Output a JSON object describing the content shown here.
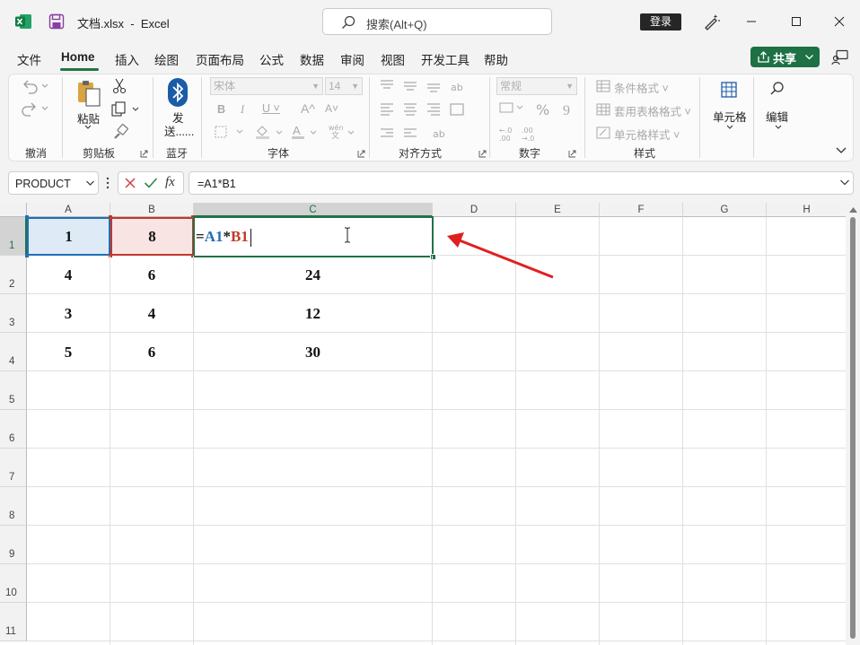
{
  "window": {
    "filename": "文档.xlsx",
    "separator": "-",
    "app": "Excel",
    "search_placeholder": "搜索(Alt+Q)",
    "login_label": "登录"
  },
  "tabs": [
    "文件",
    "Home",
    "插入",
    "绘图",
    "页面布局",
    "公式",
    "数据",
    "审阅",
    "视图",
    "开发工具",
    "帮助"
  ],
  "active_tab": "Home",
  "share_label": "共享",
  "ribbon": {
    "undo_group": "撤消",
    "clipboard": {
      "paste": "粘贴",
      "label": "剪贴板"
    },
    "bluetooth": {
      "send_line1": "发",
      "send_line2": "送......",
      "label": "蓝牙"
    },
    "font": {
      "name": "宋体",
      "size": "14",
      "label": "字体"
    },
    "alignment": {
      "label": "对齐方式"
    },
    "number": {
      "format": "常规",
      "label": "数字"
    },
    "styles": {
      "conditional": "条件格式",
      "table": "套用表格格式",
      "cell_styles": "单元格样式",
      "label": "样式"
    },
    "cells_label": "单元格",
    "editing_label": "编辑"
  },
  "formula_bar": {
    "name_box": "PRODUCT",
    "formula": "=A1*B1"
  },
  "sheet": {
    "columns": [
      "A",
      "B",
      "C",
      "D",
      "E",
      "F",
      "G",
      "H"
    ],
    "rows": [
      "1",
      "2",
      "3",
      "4",
      "5",
      "6",
      "7",
      "8",
      "9",
      "10",
      "11"
    ],
    "data": [
      [
        "1",
        "8",
        ""
      ],
      [
        "4",
        "6",
        "24"
      ],
      [
        "3",
        "4",
        "12"
      ],
      [
        "5",
        "6",
        "30"
      ]
    ],
    "editing": {
      "eq": "=",
      "ref1": "A1",
      "op": "*",
      "ref2": "B1"
    }
  },
  "colors": {
    "accent": "#217346",
    "ref_a": "#1f6fb5",
    "ref_b": "#c0392b",
    "annotation_arrow": "#e02020"
  }
}
